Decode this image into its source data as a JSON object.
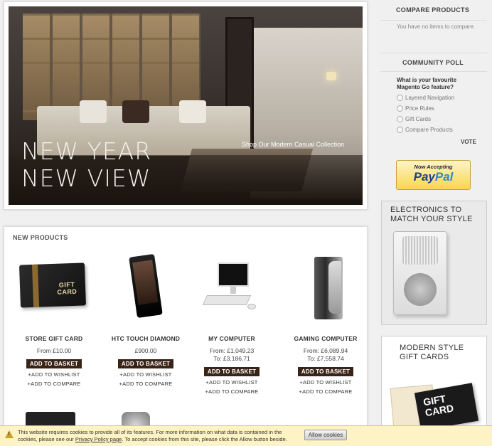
{
  "hero": {
    "title_line1": "NEW YEAR",
    "title_line2": "NEW VIEW",
    "link": "Shop Our Modern Casual Collection"
  },
  "new_products": {
    "heading": "NEW PRODUCTS",
    "items": [
      {
        "name": "STORE GIFT CARD",
        "price_line1": "From £10.00",
        "price_line2": "",
        "basket": "ADD TO BASKET",
        "wishlist": "+ADD TO WISHLIST",
        "compare": "+ADD TO COMPARE",
        "image_label": "GIFT CARD"
      },
      {
        "name": "HTC TOUCH DIAMOND",
        "price_line1": "£900.00",
        "price_line2": "",
        "basket": "ADD TO BASKET",
        "wishlist": "+ADD TO WISHLIST",
        "compare": "+ADD TO COMPARE"
      },
      {
        "name": "MY COMPUTER",
        "price_line1": "From: £1,049.23",
        "price_line2": "To: £3,186.71",
        "basket": "ADD TO BASKET",
        "wishlist": "+ADD TO WISHLIST",
        "compare": "+ADD TO COMPARE"
      },
      {
        "name": "GAMING COMPUTER",
        "price_line1": "From: £6,089.94",
        "price_line2": "To: £7,558.74",
        "basket": "ADD TO BASKET",
        "wishlist": "+ADD TO WISHLIST",
        "compare": "+ADD TO COMPARE"
      }
    ]
  },
  "compare_products": {
    "title": "COMPARE PRODUCTS",
    "empty_text": "You have no items to compare."
  },
  "community_poll": {
    "title": "COMMUNITY POLL",
    "question": "What is your favourite Magento Go feature?",
    "options": [
      "Layered Navigation",
      "Price Rules",
      "Gift Cards",
      "Compare Products"
    ],
    "vote": "VOTE"
  },
  "paypal": {
    "now": "Now Accepting",
    "pay": "Pay",
    "pal": "Pal"
  },
  "ads": {
    "electronics": "ELECTRONICS TO MATCH YOUR STYLE",
    "gift_cards": "MODERN STYLE GIFT CARDS",
    "gift_card_image": "GIFT CARD"
  },
  "cookie_bar": {
    "message_part1": "This website requires cookies to provide all of its features. For more information on what data is contained in the cookies, please see our ",
    "policy_link": "Privacy Policy page",
    "message_part2": ". To accept cookies from this site, please click the Allow button beside.",
    "allow_button": "Allow cookies"
  }
}
